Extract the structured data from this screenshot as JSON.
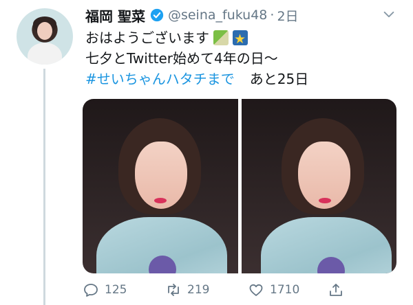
{
  "user": {
    "display_name": "福岡 聖菜",
    "handle": "@seina_fuku48",
    "separator": "·",
    "time": "2日",
    "verified": true
  },
  "tweet": {
    "line1": "おはようございます",
    "line2": "七夕とTwitter始めて4年の日〜",
    "hashtag": "#せいちゃんハタチまで",
    "tail": "あと25日",
    "emojis": [
      "tanabata-tree",
      "glowing-star"
    ]
  },
  "media": {
    "count": 2
  },
  "actions": {
    "reply_count": "125",
    "retweet_count": "219",
    "like_count": "1710"
  },
  "colors": {
    "link": "#1b95e0",
    "muted": "#657786",
    "verified": "#1da1f2",
    "thread_line": "#cfd9de"
  }
}
